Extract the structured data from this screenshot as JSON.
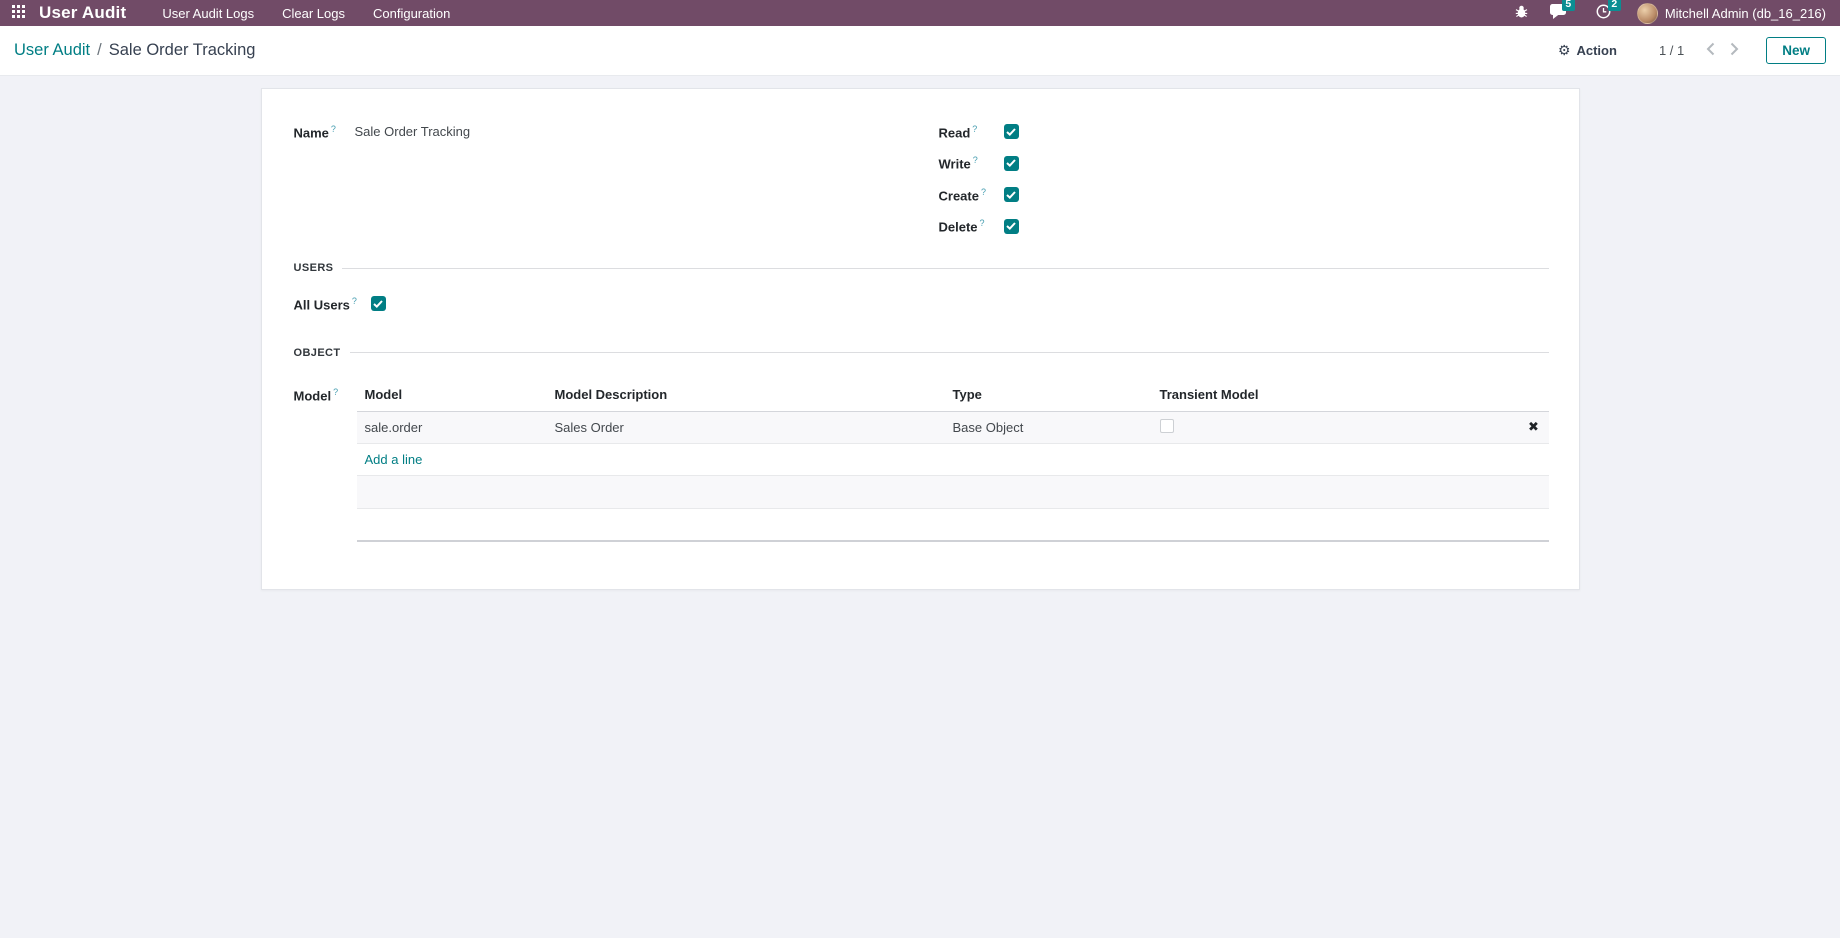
{
  "ui": {
    "help_marker": "?"
  },
  "colors": {
    "accent": "#017E84",
    "navbar_bg": "#714B67",
    "badge": "#0B8E93"
  },
  "navbar": {
    "brand": "User Audit",
    "menu_items": [
      {
        "label": "User Audit Logs"
      },
      {
        "label": "Clear Logs"
      },
      {
        "label": "Configuration"
      }
    ],
    "systray": {
      "messages_count": "5",
      "activities_count": "2",
      "user_name": "Mitchell Admin (db_16_216)"
    }
  },
  "control_panel": {
    "breadcrumb": {
      "parent": "User Audit",
      "separator": "/",
      "current": "Sale Order Tracking"
    },
    "action_label": "Action",
    "pager": {
      "value": "1 / 1"
    },
    "new_button_label": "New"
  },
  "form": {
    "name": {
      "label": "Name",
      "value": "Sale Order Tracking"
    },
    "permissions": [
      {
        "label": "Read",
        "checked": true
      },
      {
        "label": "Write",
        "checked": true
      },
      {
        "label": "Create",
        "checked": true
      },
      {
        "label": "Delete",
        "checked": true
      }
    ],
    "sections": {
      "users": "USERS",
      "object": "OBJECT"
    },
    "all_users": {
      "label": "All Users",
      "checked": true
    },
    "model_field_label": "Model",
    "model_table": {
      "headers": [
        "Model",
        "Model Description",
        "Type",
        "Transient Model"
      ],
      "rows": [
        {
          "model": "sale.order",
          "description": "Sales Order",
          "type": "Base Object",
          "transient": false
        }
      ],
      "add_line_label": "Add a line"
    }
  }
}
